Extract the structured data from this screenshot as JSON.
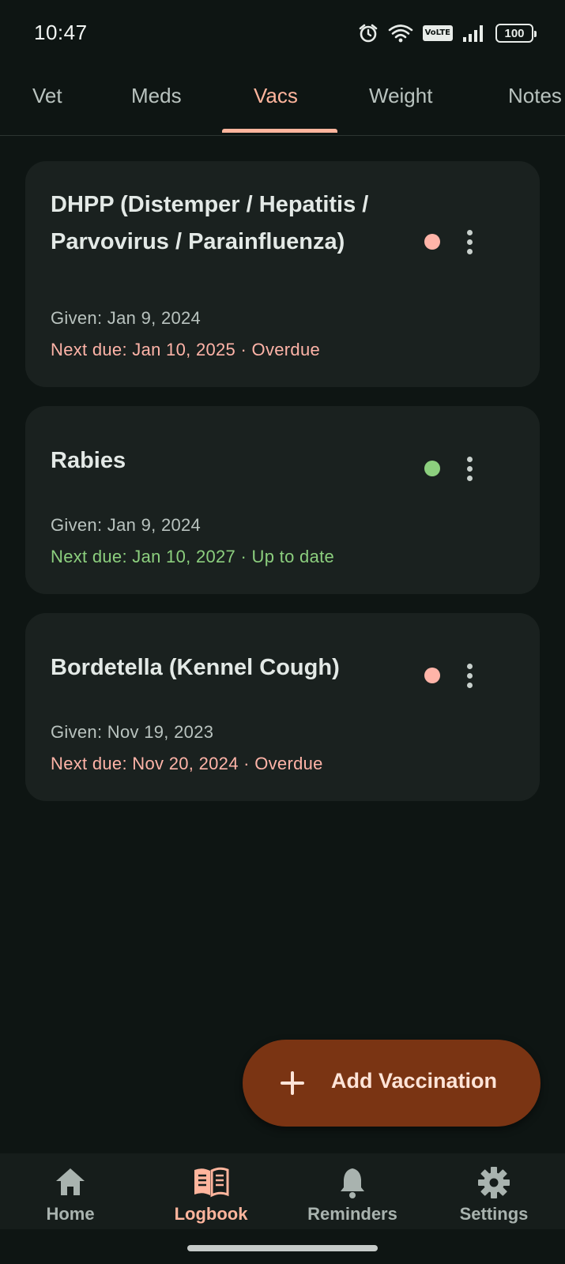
{
  "status_bar": {
    "time": "10:47",
    "volte": "VoLTE",
    "battery": "100",
    "icons": [
      "alarm-icon",
      "wifi-icon",
      "volte-badge",
      "signal-icon",
      "battery-icon"
    ]
  },
  "tabs": [
    {
      "label": "Vet",
      "active": false
    },
    {
      "label": "Meds",
      "active": false
    },
    {
      "label": "Vacs",
      "active": true
    },
    {
      "label": "Weight",
      "active": false
    },
    {
      "label": "Notes",
      "active": false
    }
  ],
  "vaccinations": [
    {
      "name": "DHPP (Distemper / Hepatitis / Parvovirus / Parainfluenza)",
      "given": "Given: Jan 9, 2024",
      "next_due": "Next due: Jan 10, 2025 · Overdue",
      "status": "overdue"
    },
    {
      "name": "Rabies",
      "given": "Given: Jan 9, 2024",
      "next_due": "Next due: Jan 10, 2027 · Up to date",
      "status": "up-to-date"
    },
    {
      "name": "Bordetella (Kennel Cough)",
      "given": "Given: Nov 19, 2023",
      "next_due": "Next due: Nov 20, 2024 · Overdue",
      "status": "overdue"
    }
  ],
  "fab": {
    "label": "Add Vaccination",
    "icon": "plus-icon"
  },
  "bottom_nav": [
    {
      "label": "Home",
      "icon": "home-icon",
      "active": false
    },
    {
      "label": "Logbook",
      "icon": "book-icon",
      "active": true
    },
    {
      "label": "Reminders",
      "icon": "bell-icon",
      "active": false
    },
    {
      "label": "Settings",
      "icon": "gear-icon",
      "active": false
    }
  ],
  "colors": {
    "background": "#0e1513",
    "card": "#1a211f",
    "accent": "#ffb59d",
    "overdue": "#ffb4a8",
    "up_to_date": "#8ccf7e",
    "fab": "#7a3413"
  }
}
